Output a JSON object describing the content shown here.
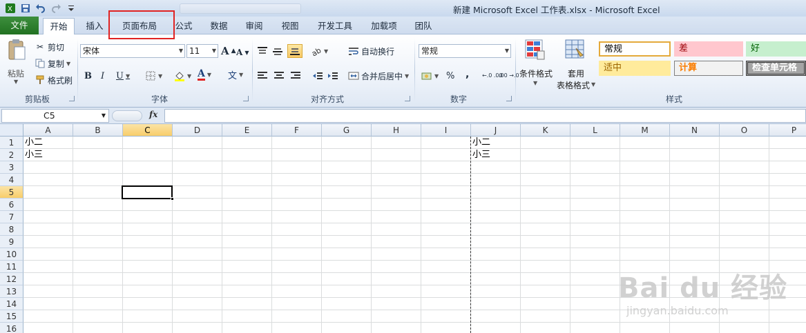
{
  "window": {
    "title": "新建 Microsoft Excel 工作表.xlsx  -  Microsoft Excel"
  },
  "quick_access": [
    {
      "icon": "save-icon"
    },
    {
      "icon": "undo-icon"
    },
    {
      "icon": "redo-icon"
    },
    {
      "icon": "customize-qat-icon"
    }
  ],
  "tabs": {
    "file": "文件",
    "home": "开始",
    "insert": "插入",
    "page_layout": "页面布局",
    "formulas": "公式",
    "data": "数据",
    "review": "审阅",
    "view": "视图",
    "developer": "开发工具",
    "addins": "加载项",
    "team": "团队"
  },
  "highlight_color": "#e02222",
  "ribbon": {
    "clipboard": {
      "label": "剪贴板",
      "paste": "粘贴",
      "cut": "剪切",
      "copy": "复制",
      "format_painter": "格式刷"
    },
    "font": {
      "label": "字体",
      "name": "宋体",
      "size": "11",
      "bold": "B",
      "italic": "I",
      "underline": "U",
      "grow": "A",
      "shrink": "A",
      "color_letter": "A",
      "phonetic": "文"
    },
    "alignment": {
      "label": "对齐方式",
      "wrap": "自动换行",
      "merge": "合并后居中"
    },
    "number": {
      "label": "数字",
      "format": "常规",
      "percent": "%",
      "comma": ",",
      "inc_decimal": "←.0 .00",
      "dec_decimal": ".00 →.0"
    },
    "styles": {
      "label": "样式",
      "conditional": "条件格式",
      "table_a": "套用",
      "table_b": "表格格式",
      "normal": "常规",
      "bad": "差",
      "good": "好",
      "neutral": "适中",
      "calc": "计算",
      "check": "检查单元格"
    }
  },
  "formula_bar": {
    "name_box": "C5",
    "fx": "fx",
    "formula": ""
  },
  "sheet": {
    "columns": [
      "A",
      "B",
      "C",
      "D",
      "E",
      "F",
      "G",
      "H",
      "I",
      "J",
      "K",
      "L",
      "M",
      "N",
      "O",
      "P"
    ],
    "selected_column": "C",
    "rows": [
      "1",
      "2",
      "3",
      "4",
      "5",
      "6",
      "7",
      "8",
      "9",
      "10",
      "11",
      "12",
      "13",
      "14",
      "15",
      "16"
    ],
    "selected_row": "5",
    "active_cell": "C5",
    "cells": {
      "A1": "小二",
      "A2": "小三",
      "J1": "小二",
      "J2": "小三"
    }
  },
  "watermark": {
    "main": "Bai du 经验",
    "sub": "jingyan.baidu.com"
  }
}
